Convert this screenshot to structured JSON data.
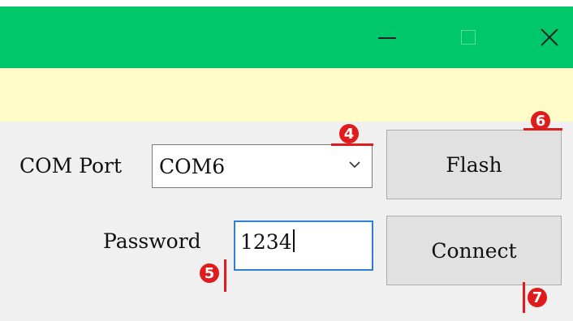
{
  "colors": {
    "titlebar": "#00c86a",
    "banner": "#fffcc8",
    "content_bg": "#f0f0f0",
    "button_bg": "#e1e1e1",
    "focus_border": "#2f7fd2",
    "annotation": "#e01b1b"
  },
  "titlebar": {
    "icons": [
      "minimize-icon",
      "maximize-icon",
      "close-icon"
    ]
  },
  "form": {
    "com_port_label": "COM Port",
    "com_port_value": "COM6",
    "password_label": "Password",
    "password_value": "1234"
  },
  "buttons": {
    "flash": "Flash",
    "connect": "Connect"
  },
  "annotations": {
    "n4": "4",
    "n5": "5",
    "n6": "6",
    "n7": "7"
  }
}
